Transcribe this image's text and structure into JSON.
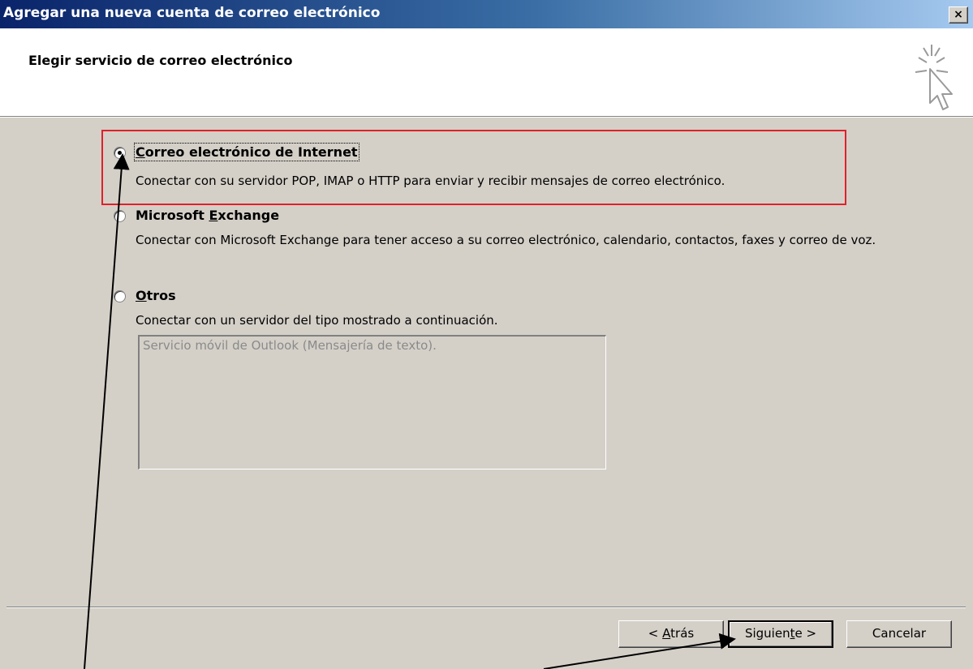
{
  "window": {
    "title": "Agregar una nueva cuenta de correo electrónico",
    "close_label": "×"
  },
  "header": {
    "title": "Elegir servicio de correo electrónico",
    "icon": "wizard-cursor-icon"
  },
  "options": [
    {
      "title_pre": "",
      "title_key": "C",
      "title_post": "orreo electrónico de Internet",
      "description": "Conectar con su servidor POP, IMAP o HTTP para enviar y recibir mensajes de correo electrónico.",
      "selected": true
    },
    {
      "title_pre": "Microsoft ",
      "title_key": "E",
      "title_post": "xchange",
      "description": "Conectar con Microsoft Exchange para tener acceso a su correo electrónico, calendario, contactos, faxes y correo de voz.",
      "selected": false
    },
    {
      "title_pre": "",
      "title_key": "O",
      "title_post": "tros",
      "description": "Conectar con un servidor del tipo mostrado a continuación.",
      "selected": false
    }
  ],
  "other_servers": [
    "Servicio móvil de Outlook (Mensajería de texto)."
  ],
  "buttons": {
    "back": {
      "pre": "< ",
      "key": "A",
      "post": "trás"
    },
    "next": {
      "pre": "Siguien",
      "key": "t",
      "post": "e >"
    },
    "cancel": {
      "label": "Cancelar"
    }
  },
  "colors": {
    "highlight": "#e0202a",
    "dialog_bg": "#d4d0c8",
    "titlebar_start": "#0a246a"
  }
}
